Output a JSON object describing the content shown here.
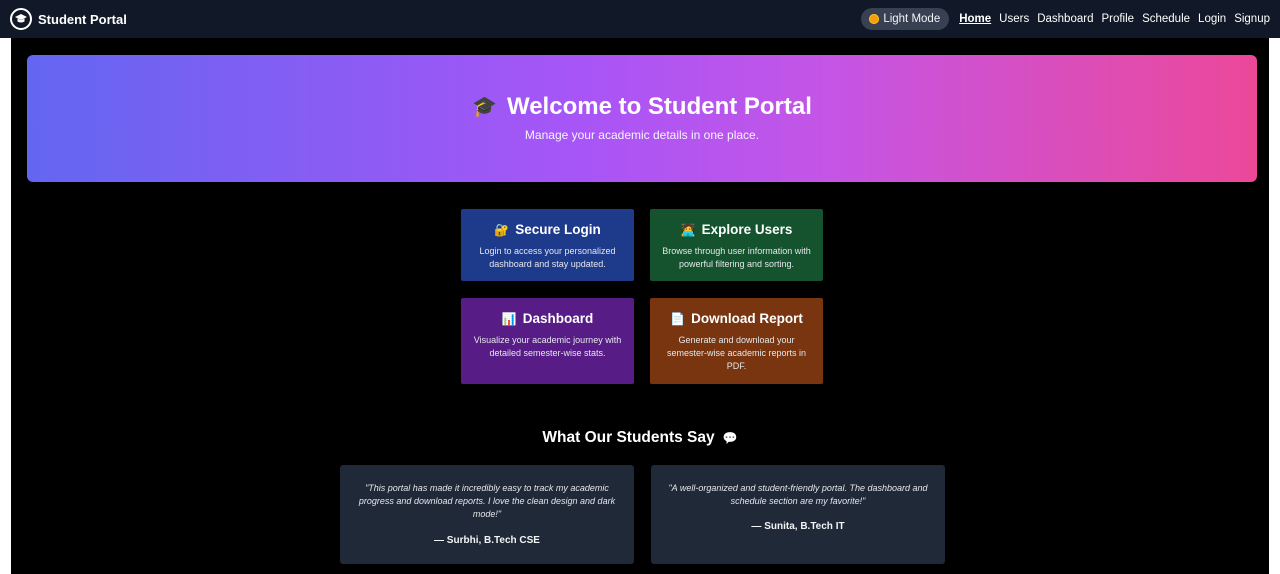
{
  "nav": {
    "brand": "Student Portal",
    "mode_toggle": "Light Mode",
    "links": [
      "Home",
      "Users",
      "Dashboard",
      "Profile",
      "Schedule",
      "Login",
      "Signup"
    ]
  },
  "hero": {
    "title": "Welcome to Student Portal",
    "subtitle": "Manage your academic details in one place.",
    "icon": "graduation-cap-icon"
  },
  "cards": [
    {
      "title": "Secure Login",
      "icon": "lock-icon",
      "emoji": "🔐",
      "desc": "Login to access your personalized dashboard and stay updated.",
      "color": "#1e3a8a"
    },
    {
      "title": "Explore Users",
      "icon": "person-icon",
      "emoji": "🧑‍💻",
      "desc": "Browse through user information with powerful filtering and sorting.",
      "color": "#14532d"
    },
    {
      "title": "Dashboard",
      "icon": "chart-icon",
      "emoji": "📊",
      "desc": "Visualize your academic journey with detailed semester-wise stats.",
      "color": "#581c87"
    },
    {
      "title": "Download Report",
      "icon": "document-icon",
      "emoji": "📄",
      "desc": "Generate and download your semester-wise academic reports in PDF.",
      "color": "#78350f"
    }
  ],
  "testimonials": {
    "heading": "What Our Students Say",
    "icon": "speech-bubble-icon",
    "items": [
      {
        "quote": "\"This portal has made it incredibly easy to track my academic progress and download reports. I love the clean design and dark mode!\"",
        "author": "— Surbhi, B.Tech CSE"
      },
      {
        "quote": "\"A well-organized and student-friendly portal. The dashboard and schedule section are my favorite!\"",
        "author": "— Sunita, B.Tech IT"
      }
    ]
  },
  "colors": {
    "nav_bg": "#111827",
    "hero_gradient": [
      "#6366f1",
      "#a855f7",
      "#ec4899"
    ],
    "testimonial_bg": "#1f2937"
  }
}
